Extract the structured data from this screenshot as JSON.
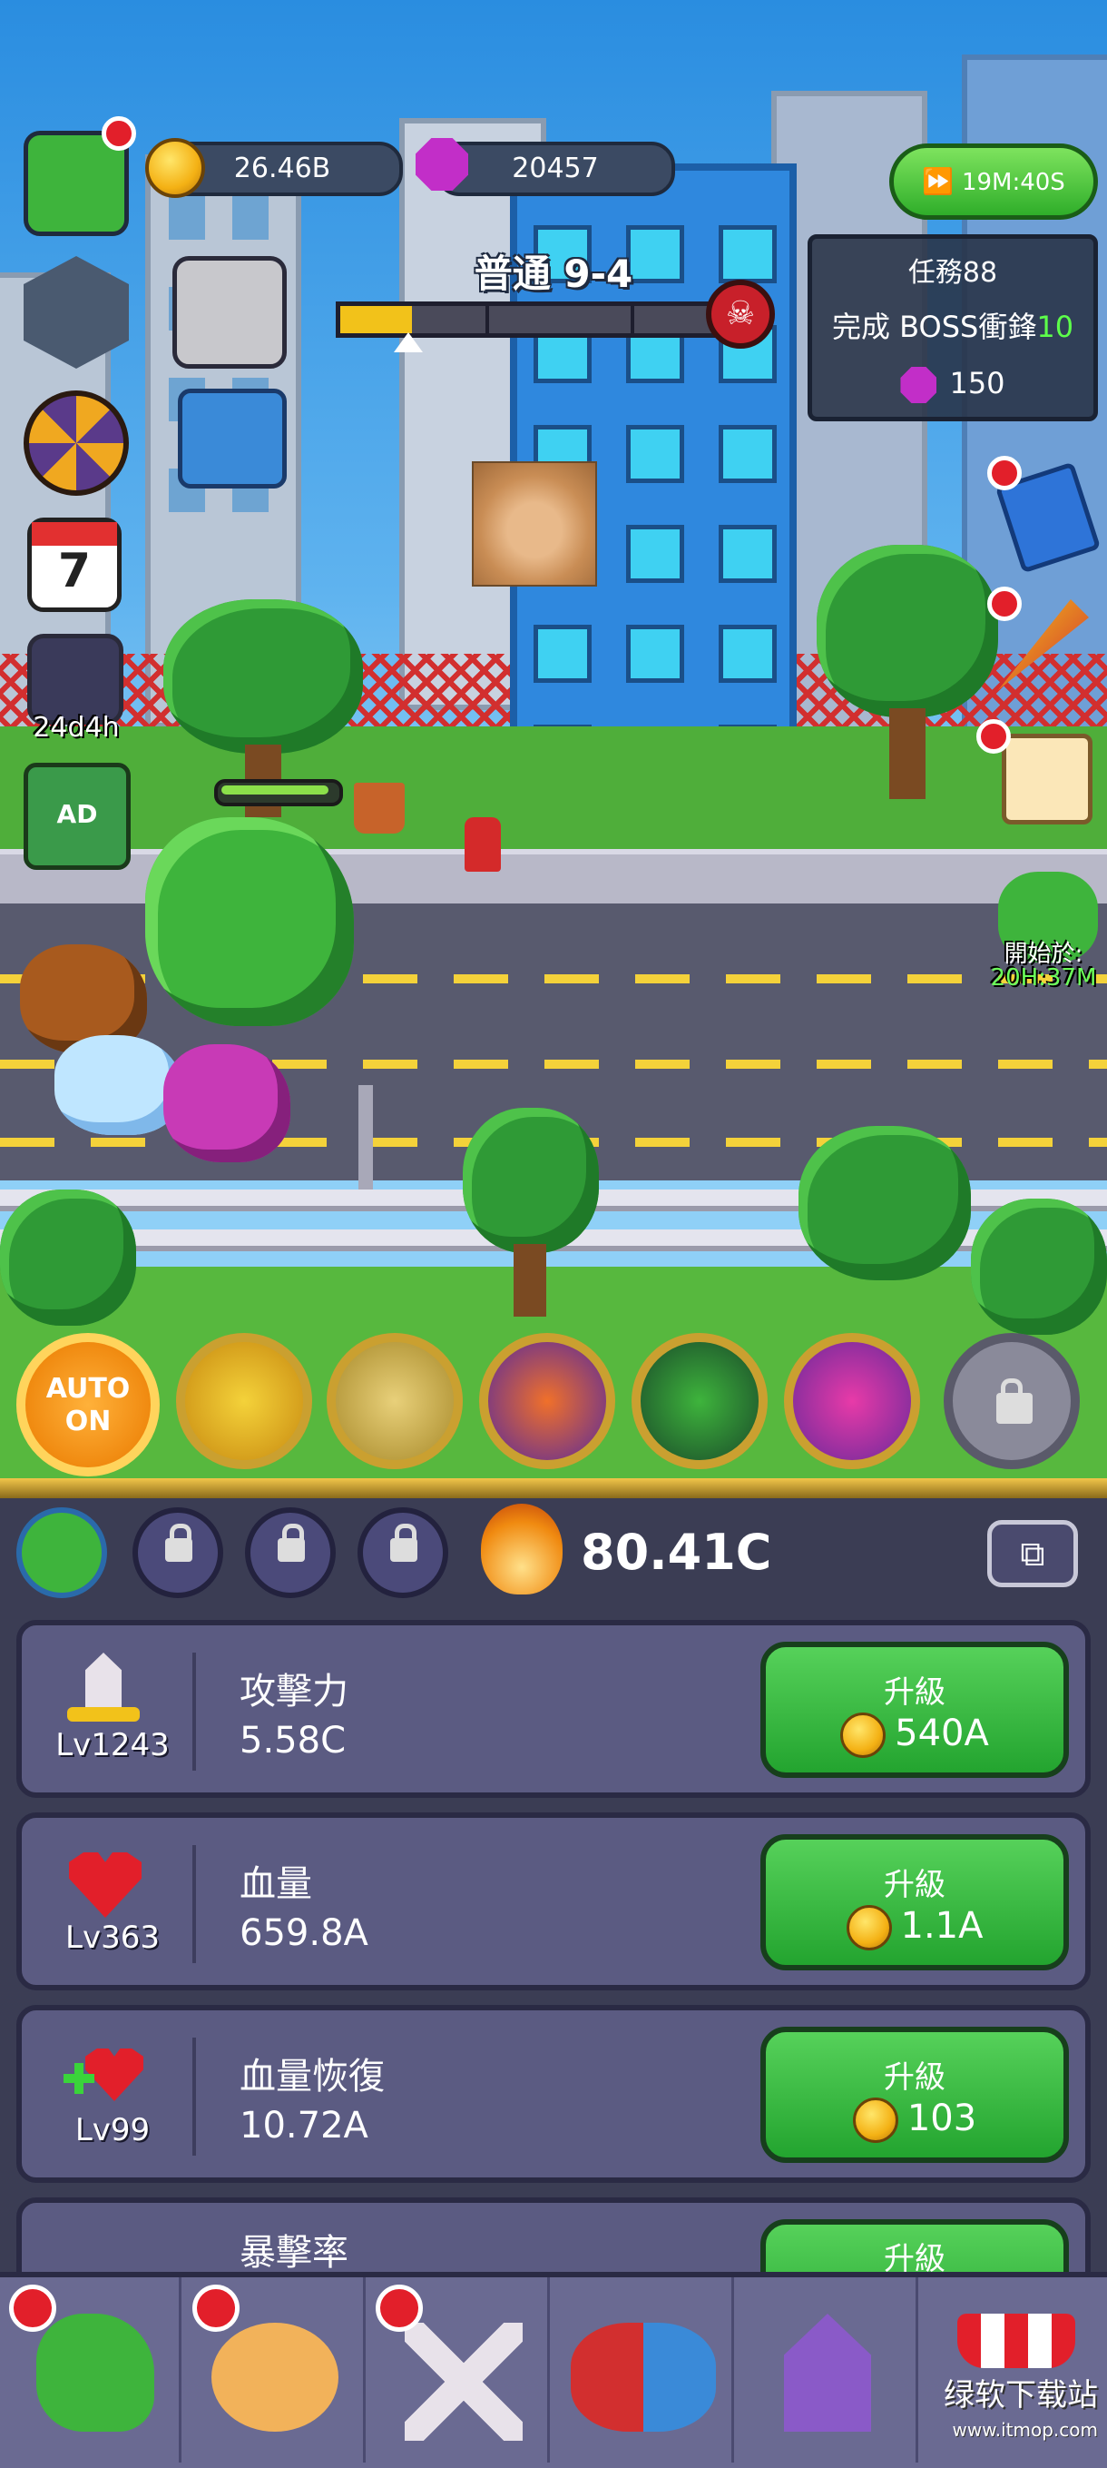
{
  "hud": {
    "gold": "26.46B",
    "gems": "20457",
    "speed_timer": "19M:40S",
    "stage": "普通 9-4",
    "stage_progress": 0.18
  },
  "quest": {
    "title": "任務88",
    "desc_prefix": "完成 BOSS衝鋒",
    "desc_count": "10",
    "reward": "150"
  },
  "side": {
    "calendar_day": "7",
    "event_timer": "24d4h",
    "start_label": "開始於:",
    "start_timer": "20H:37M"
  },
  "skills": {
    "auto_label_1": "AUTO",
    "auto_label_2": "ON"
  },
  "hero_bar": {
    "power": "80.41C"
  },
  "upgrades": [
    {
      "name": "攻擊力",
      "level": "Lv1243",
      "value": "5.58C",
      "button_label": "升級",
      "cost": "540A"
    },
    {
      "name": "血量",
      "level": "Lv363",
      "value": "659.8A",
      "button_label": "升級",
      "cost": "1.1A"
    },
    {
      "name": "血量恢復",
      "level": "Lv99",
      "value": "10.72A",
      "button_label": "升級",
      "cost": "103"
    },
    {
      "name": "暴擊率",
      "button_label": "升級"
    }
  ],
  "watermark": {
    "text": "绿软下载站",
    "url": "www.itmop.com"
  },
  "colors": {
    "accent_green": "#2fae2a",
    "gold": "#f4b114",
    "gem": "#c22ec8",
    "alert_red": "#e21f2a",
    "quest_count": "#5dff4a"
  }
}
